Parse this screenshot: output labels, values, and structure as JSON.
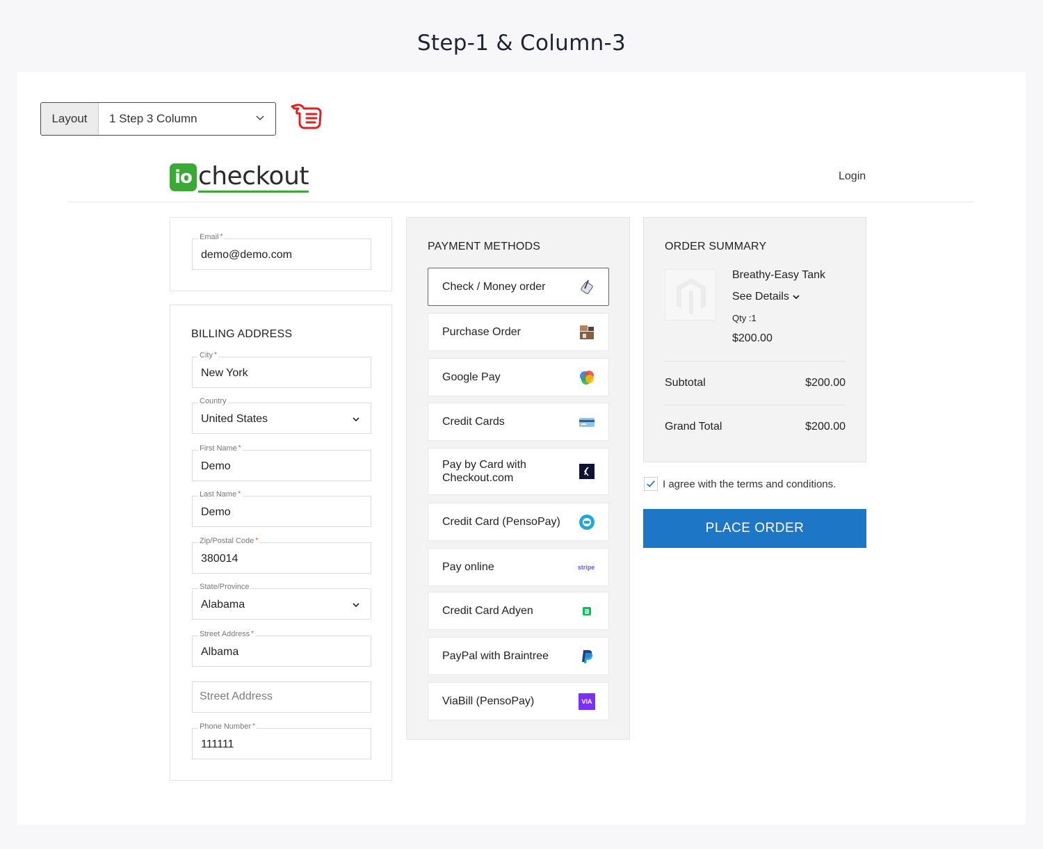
{
  "page_title": "Step-1 & Column-3",
  "layout_selector": {
    "label": "Layout",
    "value": "1 Step 3 Column"
  },
  "header": {
    "logo_io": "io",
    "logo_text": "checkout",
    "login": "Login"
  },
  "email_section": {
    "email_label": "Email",
    "email_value": "demo@demo.com"
  },
  "billing": {
    "title": "BILLING ADDRESS",
    "fields": [
      {
        "label": "City",
        "value": "New York",
        "required": "*"
      },
      {
        "label": "Country",
        "value": "United States",
        "required": ""
      },
      {
        "label": "First Name",
        "value": "Demo",
        "required": "*"
      },
      {
        "label": "Last Name",
        "value": "Demo",
        "required": "*"
      },
      {
        "label": "Zip/Postal Code",
        "value": "380014",
        "required": "*"
      },
      {
        "label": "State/Province",
        "value": "Alabama",
        "required": ""
      },
      {
        "label": "Street Address",
        "value": "Albama",
        "required": "*"
      },
      {
        "label": "",
        "placeholder": "Street Address",
        "value": "",
        "required": ""
      },
      {
        "label": "Phone Number",
        "value": "111111",
        "required": "*"
      }
    ]
  },
  "payment": {
    "title": "PAYMENT METHODS",
    "methods": [
      {
        "label": "Check / Money order",
        "icon": "pen-check-icon"
      },
      {
        "label": "Purchase Order",
        "icon": "warehouse-icon"
      },
      {
        "label": "Google Pay",
        "icon": "google-pay-icon"
      },
      {
        "label": "Credit Cards",
        "icon": "credit-card-icon"
      },
      {
        "label": "Pay by Card with Checkout.com",
        "icon": "checkout-com-icon"
      },
      {
        "label": "Credit Card (PensoPay)",
        "icon": "pensopay-icon"
      },
      {
        "label": "Pay online",
        "icon": "stripe-icon",
        "icon_text": "stripe"
      },
      {
        "label": "Credit Card Adyen",
        "icon": "adyen-icon"
      },
      {
        "label": "PayPal with Braintree",
        "icon": "paypal-icon"
      },
      {
        "label": "ViaBill (PensoPay)",
        "icon": "viabill-icon",
        "icon_text": "VIA"
      }
    ]
  },
  "summary": {
    "title": "ORDER SUMMARY",
    "product_name": "Breathy-Easy Tank",
    "see_details": "See Details",
    "qty_label": "Qty :",
    "qty_value": "1",
    "product_price": "$200.00",
    "subtotal_label": "Subtotal",
    "subtotal_value": "$200.00",
    "grand_total_label": "Grand Total",
    "grand_total_value": "$200.00"
  },
  "agree_text": "I agree with the terms and conditions.",
  "place_order": "PLACE ORDER",
  "colors": {
    "accent": "#1e76c6",
    "brand_green": "#3aa935",
    "required": "#e04848"
  }
}
